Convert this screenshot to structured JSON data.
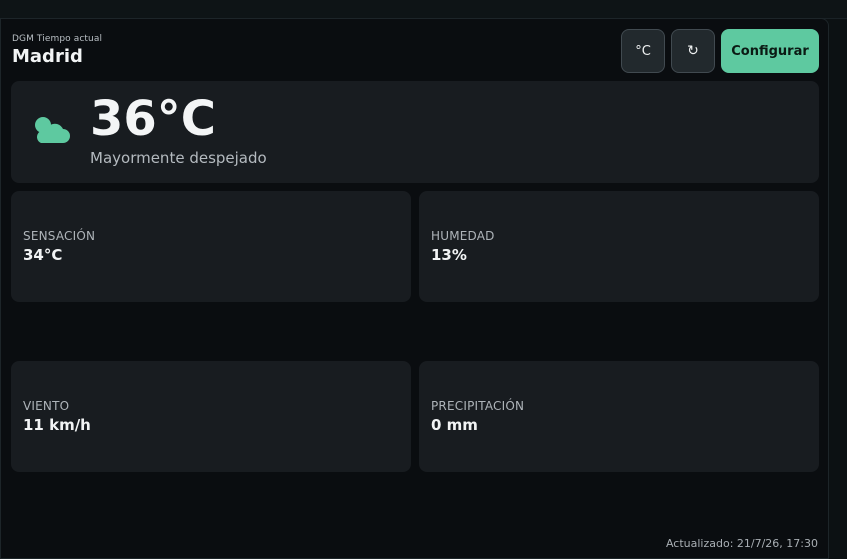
{
  "header": {
    "label": "DGM Tiempo actual",
    "city": "Madrid"
  },
  "toolbar": {
    "unit_label": "°C",
    "refresh_label": "↻",
    "config_label": "Configurar"
  },
  "current": {
    "temperature": "36°C",
    "condition": "Mayormente despejado",
    "icon": "partly-cloudy-icon",
    "icon_color": "#5ec9a0"
  },
  "stats": [
    {
      "label": "SENSACIÓN",
      "value": "34°C"
    },
    {
      "label": "HUMEDAD",
      "value": "13%"
    },
    {
      "label": "VIENTO",
      "value": "11 km/h"
    },
    {
      "label": "PRECIPITACIÓN",
      "value": "0 mm"
    }
  ],
  "footer": {
    "updated": "Actualizado: 21/7/26, 17:30"
  },
  "colors": {
    "accent": "#5ec9a0",
    "background": "#0a0d10",
    "panel": "#181c20"
  }
}
